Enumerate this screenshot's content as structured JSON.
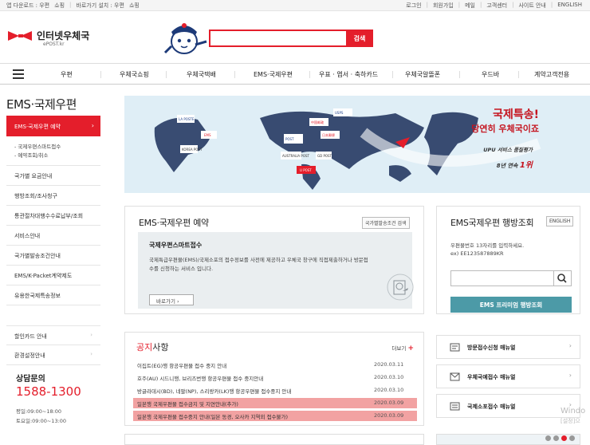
{
  "topbar": {
    "left": [
      "앱 다운로드 : 우편",
      "쇼핑",
      "바로가기 설치 : 우편",
      "쇼핑"
    ],
    "right": [
      "로그인",
      "회원가입",
      "메일",
      "고객센터",
      "사이트 안내",
      "ENGLISH"
    ]
  },
  "brand": {
    "name": "인터넷우체국",
    "sub": "ePOST.kr"
  },
  "search": {
    "placeholder": "",
    "button": "검색"
  },
  "gnb": [
    "우편",
    "우체국쇼핑",
    "우체국택배",
    "EMS·국제우편",
    "우표 · 엽서 · 축하카드",
    "우체국알뜰폰",
    "우드바",
    "계약고객전용"
  ],
  "lnb": {
    "title": "EMS·국제우편",
    "active": "EMS·국제우편 예약",
    "sub": [
      "- 국제우편스마트접수",
      "- 예약조회/취소"
    ],
    "items": [
      "국가별 요금안내",
      "행방조회/조사청구",
      "통관절차대행수수료납부/조회",
      "서비스안내",
      "국가별발송조건안내",
      "EMS/K-Packet계약제도",
      "유용한국제특송정보"
    ],
    "items2": [
      "할인카드 안내",
      "환경설정안내"
    ]
  },
  "cs": {
    "title": "상담문의",
    "phone": "1588-1300",
    "hours": [
      "평일:09:00~18:00",
      "토요일:09:00~13:00"
    ]
  },
  "banner": {
    "title1": "국제특송!",
    "title2": "당연히 우체국이죠",
    "note1": "UPU 서비스 품질평가",
    "note2a": "8년 연속",
    "note2b": "1위",
    "pins": [
      "LA POSTE",
      "EMS",
      "KOREA POST",
      "日本郵便",
      "中国邮政",
      "USPS",
      "POST",
      "AUSTRALIA POST",
      "GD POST",
      "U POST"
    ]
  },
  "ems_card": {
    "title": "EMS·국제우편 예약",
    "cond_button": "국가별발송조건 검색",
    "inner_title": "국제우편스마트접수",
    "inner_desc": "국제특급우편물(EMS)/국제소포의 접수정보를 사전에 제공하고 우체국 창구에 직접제출하거나 방문접수를 신청하는 서비스 입니다.",
    "go": "바로가기"
  },
  "track": {
    "title": "EMS국제우편 행방조회",
    "lang": "ENGLISH",
    "desc1": "우편물번호 13자리를 입력하세요.",
    "desc2": "ex) EE123587889KR",
    "button": "EMS 프리미엄 행방조회"
  },
  "notice": {
    "title_red": "공지",
    "title_rest": "사항",
    "more": "더보기",
    "rows": [
      {
        "title": "이집트(EG)행 항공우편물 접수 중지 안내",
        "date": "2020.03.11",
        "hl": false
      },
      {
        "title": "호주(AU) 시드니행, 브리즈번행 항공우편물 접수 중지안내",
        "date": "2020.03.10",
        "hl": false
      },
      {
        "title": "방글라데시(BD), 네팔(NP), 스리랑카(LK)행 항공우편물 접수중지 안내",
        "date": "2020.03.10",
        "hl": false
      },
      {
        "title": "일본행 국제우편물 접수금지 및 지연안내(추가)",
        "date": "2020.03.09",
        "hl": true
      },
      {
        "title": "일본행 국제우편물 접수중지 안내(일본 동경, 오사카 지역외 접수불가)",
        "date": "2020.03.09",
        "hl": true
      }
    ]
  },
  "quick": [
    "방문접수신청 매뉴얼",
    "우체국예접수 매뉴얼",
    "국제소포접수 매뉴얼"
  ],
  "watermark": {
    "line1": "Windo",
    "line2": "[설정]으"
  }
}
